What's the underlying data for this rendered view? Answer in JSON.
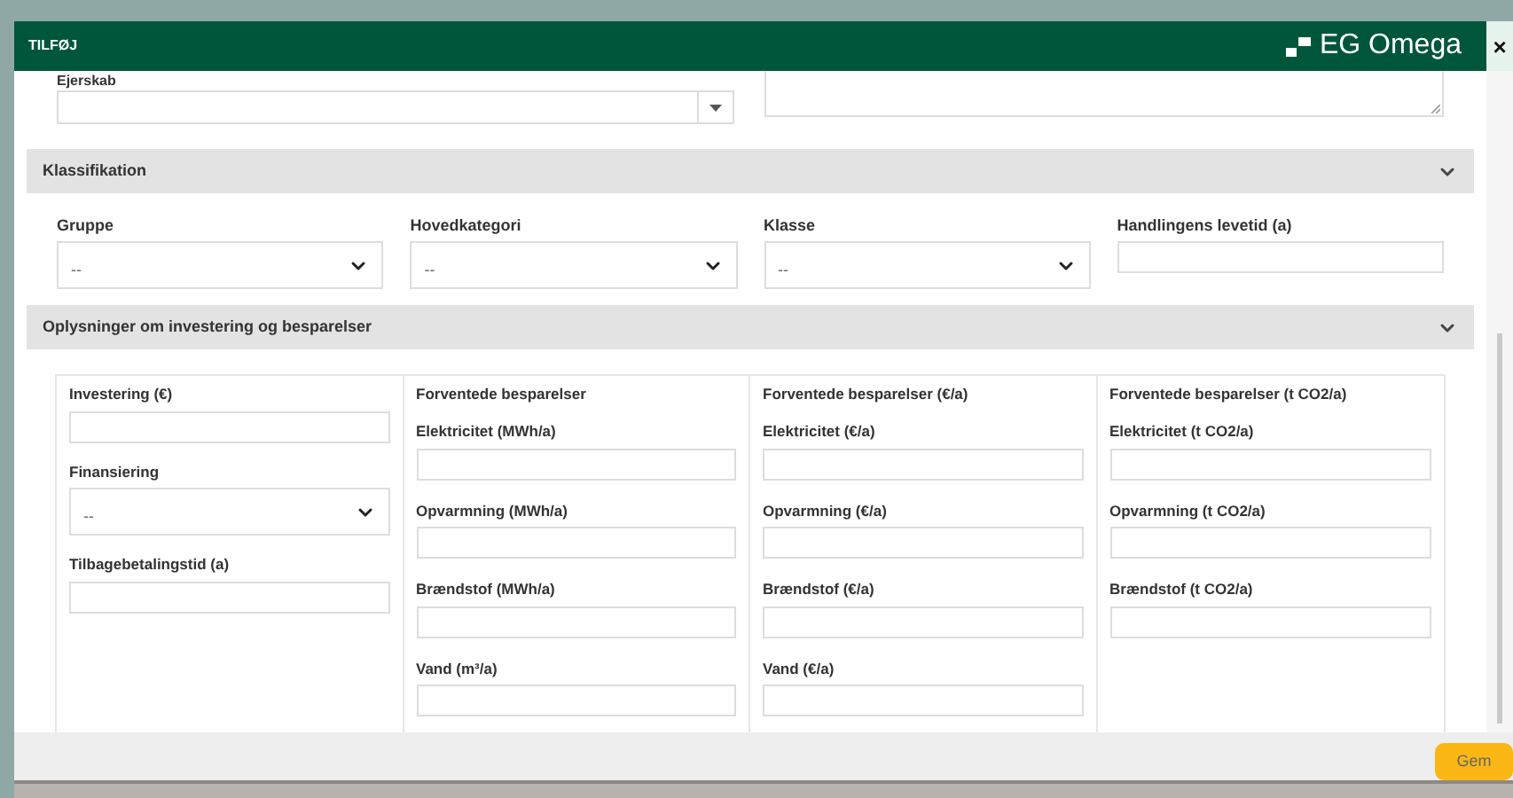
{
  "dialog": {
    "title": "TILFØJ",
    "brand": "EG Omega",
    "close": "×"
  },
  "ownership": {
    "label": "Ejerskab"
  },
  "sections": [
    {
      "title": "Klassifikation",
      "expanded": true
    },
    {
      "title": "Oplysninger om investering og besparelser",
      "expanded": true
    }
  ],
  "classification_fields": [
    {
      "label": "Gruppe",
      "kind": "select",
      "value": "--"
    },
    {
      "label": "Hovedkategori",
      "kind": "select",
      "value": "--"
    },
    {
      "label": "Klasse",
      "kind": "select",
      "value": "--"
    },
    {
      "label": "Handlingens levetid (a)",
      "kind": "text"
    }
  ],
  "investment_columns": [
    {
      "fields": [
        {
          "label": "Investering (€)",
          "kind": "text"
        },
        {
          "label": "Finansiering",
          "kind": "select",
          "value": "--"
        },
        {
          "label": "Tilbagebetalingstid (a)",
          "kind": "text"
        }
      ]
    },
    {
      "heading": "Forventede besparelser",
      "fields": [
        {
          "label": "Elektricitet (MWh/a)",
          "kind": "text"
        },
        {
          "label": "Opvarmning (MWh/a)",
          "kind": "text"
        },
        {
          "label": "Brændstof (MWh/a)",
          "kind": "text"
        },
        {
          "label": "Vand (m³/a)",
          "kind": "text"
        }
      ]
    },
    {
      "heading": "Forventede besparelser (€/a)",
      "fields": [
        {
          "label": "Elektricitet (€/a)",
          "kind": "text"
        },
        {
          "label": "Opvarmning (€/a)",
          "kind": "text"
        },
        {
          "label": "Brændstof (€/a)",
          "kind": "text"
        },
        {
          "label": "Vand (€/a)",
          "kind": "text"
        }
      ]
    },
    {
      "heading": "Forventede besparelser (t CO2/a)",
      "fields": [
        {
          "label": "Elektricitet (t CO2/a)",
          "kind": "text"
        },
        {
          "label": "Opvarmning (t CO2/a)",
          "kind": "text"
        },
        {
          "label": "Brændstof (t CO2/a)",
          "kind": "text"
        }
      ]
    }
  ],
  "footer": {
    "save": "Gem"
  }
}
